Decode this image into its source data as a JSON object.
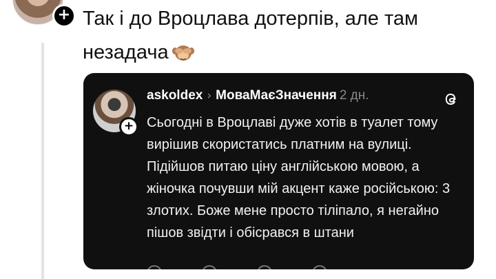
{
  "post": {
    "text": "Так і до Вроцлава дотерпів, але там незадача",
    "emoji_icon": "see-no-evil-monkey-emoji"
  },
  "quoted_post": {
    "username": "askoldex",
    "community": "МоваМаєЗначення",
    "time": "2 дн.",
    "body": "Сьогодні в Вроцлаві дуже хотів в туалет тому вирішив скористатись платним на вулиці. Підійшов питаю ціну англійською мовою, а жіночка почувши мій акцент каже російською: 3 злотих. Боже мене просто тіліпало, я негайно пішов звідти і обісрався в штани",
    "app_icon": "threads-logo-icon"
  },
  "colors": {
    "card_background": "#101010",
    "muted_text": "#8a8a8a",
    "thread_line": "#e3e3e3"
  }
}
